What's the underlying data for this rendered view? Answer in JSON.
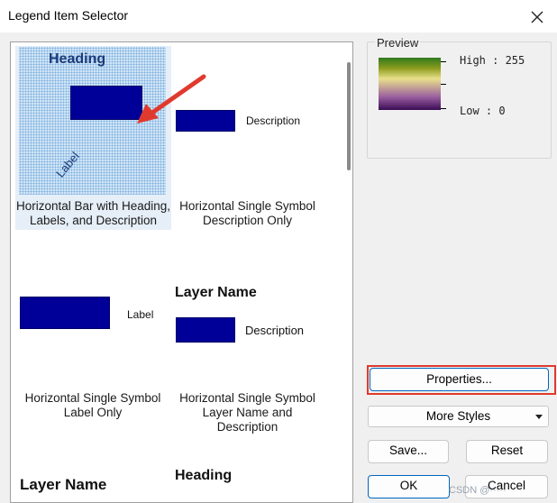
{
  "window": {
    "title": "Legend Item Selector"
  },
  "styles": [
    {
      "caption": "Horizontal Bar with Heading, Labels, and Description",
      "heading": "Heading",
      "label": "Label",
      "selected": true
    },
    {
      "caption": "Horizontal Single Symbol Description Only",
      "description": "Description"
    },
    {
      "caption": "Horizontal Single Symbol Label Only",
      "label": "Label"
    },
    {
      "caption": "Horizontal Single Symbol Layer Name and Description",
      "layer_name": "Layer Name",
      "description": "Description"
    },
    {
      "layer_name": "Layer Name"
    },
    {
      "heading": "Heading"
    }
  ],
  "preview": {
    "title": "Preview",
    "high_label": "High : 255",
    "low_label": "Low : 0"
  },
  "buttons": {
    "properties": "Properties...",
    "more_styles": "More Styles",
    "save": "Save...",
    "reset": "Reset",
    "ok": "OK",
    "cancel": "Cancel"
  },
  "colors": {
    "symbol": "#000099",
    "highlight": "#e03a2e",
    "arrow": "#e03a2e"
  },
  "watermark": "CSDN @·····"
}
